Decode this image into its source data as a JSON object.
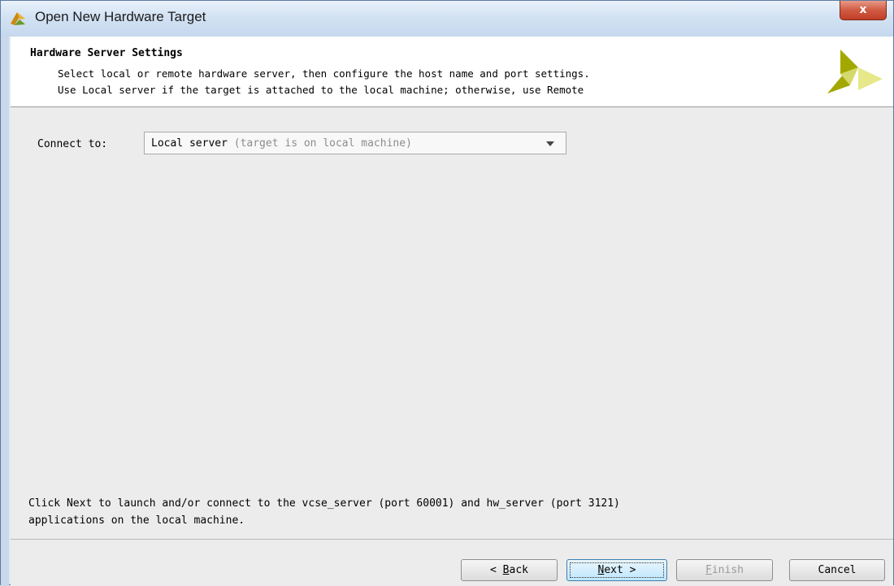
{
  "window": {
    "title": "Open New Hardware Target",
    "close_label": "x"
  },
  "header": {
    "title": "Hardware Server Settings",
    "line1": "Select local or remote hardware server, then configure the host name and port settings.",
    "line2": "Use Local server if the target is attached to the local machine; otherwise, use Remote"
  },
  "connect": {
    "label": "Connect to:",
    "value": "Local server",
    "hint": "(target is on local machine)"
  },
  "message": {
    "line1": "Click Next to launch and/or connect to the vcse_server (port 60001) and hw_server (port 3121)",
    "line2": "applications on the local machine."
  },
  "buttons": {
    "back": {
      "prefix": "< ",
      "mnemonic": "B",
      "rest": "ack"
    },
    "next": {
      "mnemonic": "N",
      "rest": "ext",
      "suffix": " >"
    },
    "finish": {
      "mnemonic": "F",
      "rest": "inish"
    },
    "cancel": "Cancel"
  },
  "colors": {
    "logo_dark": "#a3a800",
    "logo_light": "#e6e88a"
  }
}
